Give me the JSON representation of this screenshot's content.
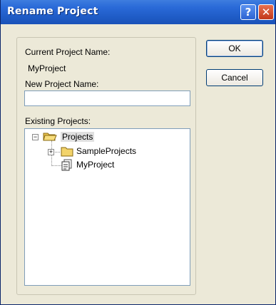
{
  "window": {
    "title": "Rename Project"
  },
  "titlebar": {
    "help_symbol": "?",
    "close_symbol": "✕"
  },
  "form": {
    "current_label": "Current Project Name:",
    "current_value": "MyProject",
    "new_label": "New Project Name:",
    "new_value": "",
    "existing_label": "Existing Projects:"
  },
  "buttons": {
    "ok": "OK",
    "cancel": "Cancel"
  },
  "tree": {
    "root": {
      "label": "Projects",
      "expander": "−"
    },
    "children": [
      {
        "label": "SampleProjects",
        "expander": "+",
        "icon": "folder-icon"
      },
      {
        "label": "MyProject",
        "icon": "project-file-icon"
      }
    ]
  },
  "colors": {
    "titlebar": "#2a6ad8",
    "dialog": "#ece9d8",
    "folder": "#f2d36b"
  }
}
